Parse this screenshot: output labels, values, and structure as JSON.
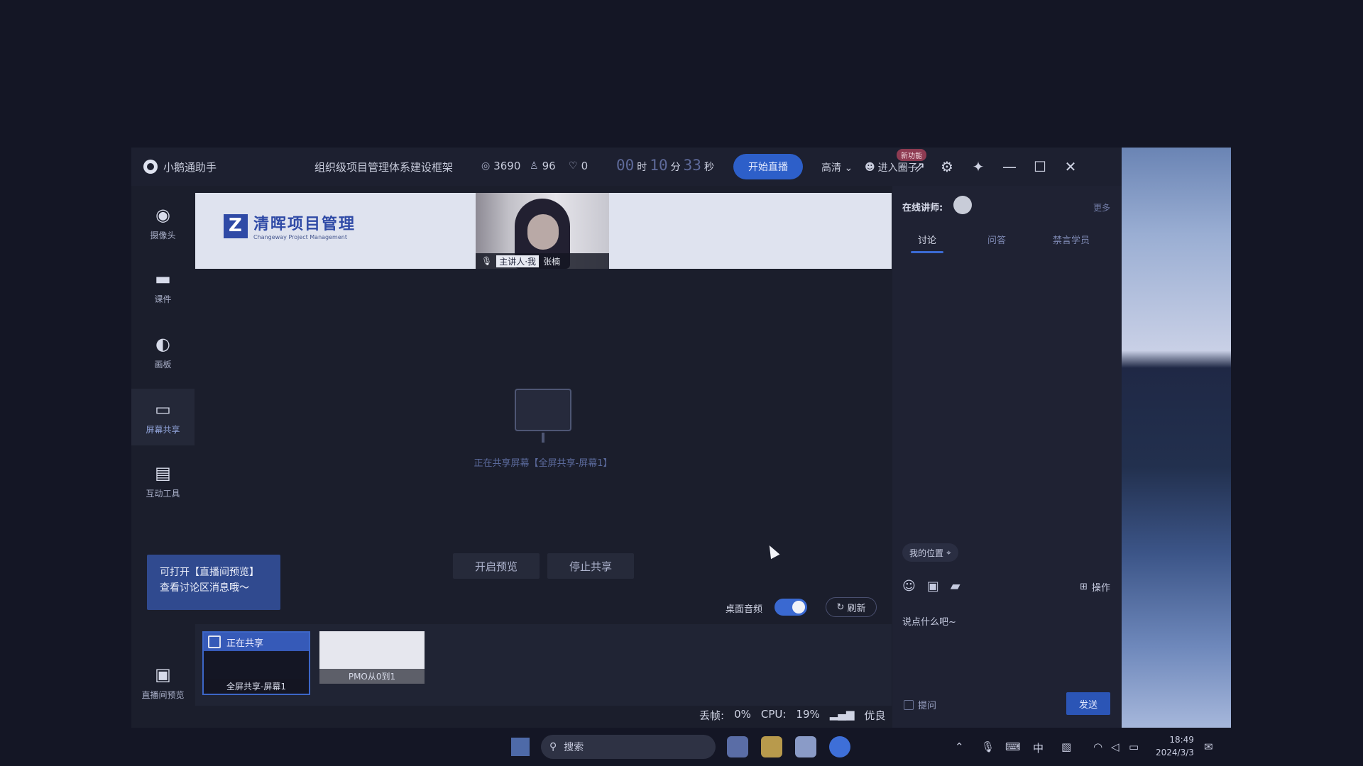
{
  "titlebar": {
    "app_name": "小鹅通助手",
    "course_title": "组织级项目管理体系建设框架",
    "views": "3690",
    "online": "96",
    "likes": "0",
    "timer": {
      "hours": "00",
      "h_unit": "时",
      "minutes": "10",
      "m_unit": "分",
      "seconds": "33",
      "s_unit": "秒"
    },
    "start_live_label": "开始直播",
    "quality_label": "高清",
    "join_label": "进入圈子",
    "join_badge": "新功能"
  },
  "rail": {
    "camera": "摄像头",
    "courseware": "课件",
    "whiteboard": "画板",
    "screen_share": "屏幕共享",
    "interactive_tools": "互动工具",
    "live_preview": "直播间预览"
  },
  "banner": {
    "logo_cn": "清晖项目管理",
    "logo_en": "Changeway Project Management",
    "host_tag": "主讲人·我",
    "host_name": "张楠"
  },
  "share": {
    "status_text": "正在共享屏幕【全屏共享-屏幕1】",
    "preview_button": "开启预览",
    "stop_button": "停止共享",
    "desktop_audio_label": "桌面音频",
    "desktop_audio_on": true,
    "refresh_label": "刷新"
  },
  "tooltip": {
    "line1": "可打开【直播间预览】",
    "line2": "查看讨论区消息哦～"
  },
  "thumbnails": [
    {
      "header": "正在共享",
      "caption": "全屏共享-屏幕1"
    },
    {
      "caption": "PMO从0到1"
    }
  ],
  "status": {
    "drop_label": "丢帧:",
    "drop_value": "0%",
    "cpu_label": "CPU:",
    "cpu_value": "19%",
    "network": "优良"
  },
  "panel": {
    "lecturer_label": "在线讲师:",
    "more_label": "更多",
    "tabs": [
      "讨论",
      "问答",
      "禁言学员"
    ],
    "location_label": "我的位置",
    "ops_label": "操作",
    "input_placeholder": "说点什么吧~",
    "ask_label": "提问",
    "send_label": "发送"
  },
  "taskbar": {
    "search_placeholder": "搜索",
    "ime": "中",
    "time": "18:49",
    "date": "2024/3/3"
  },
  "colors": {
    "accent": "#2d5fc9",
    "background": "#141625",
    "panel": "#1f2233"
  }
}
